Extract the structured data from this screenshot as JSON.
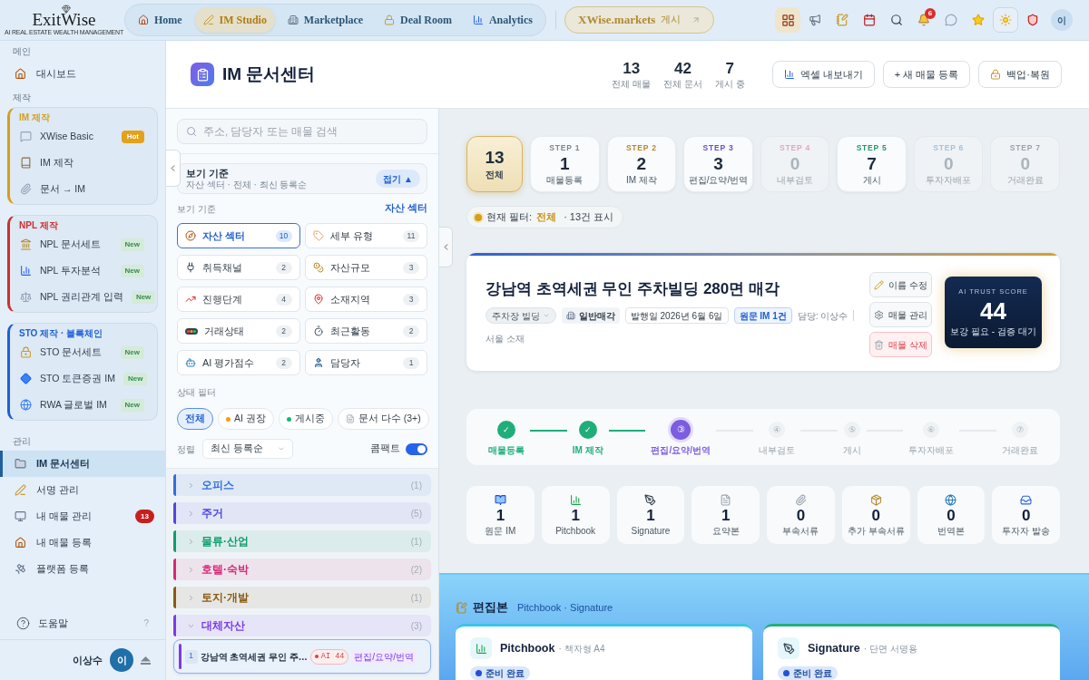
{
  "topbar": {
    "logo": {
      "wordmark": "ExitWise",
      "tagline": "AI REAL ESTATE WEALTH MANAGEMENT"
    },
    "nav": [
      {
        "label": "Home",
        "selected": false
      },
      {
        "label": "IM Studio",
        "selected": true
      },
      {
        "label": "Marketplace",
        "selected": false
      },
      {
        "label": "Deal Room",
        "selected": false
      },
      {
        "label": "Analytics",
        "selected": false
      }
    ],
    "publish_button": {
      "label": "XWise.markets",
      "suffix": "게시"
    },
    "notification_count": "6",
    "avatar": "이"
  },
  "sidebar": {
    "sections": [
      {
        "title": "메인",
        "entries": [
          {
            "kind": "item",
            "label": "대시보드",
            "selected": false
          }
        ]
      },
      {
        "title": "제작",
        "entries": [
          {
            "kind": "group",
            "title": "IM 제작",
            "color": "#d69e1c",
            "items": [
              {
                "label": "XWise Basic",
                "selected": false,
                "badge": {
                  "kind": "hot",
                  "text": "Hot"
                }
              },
              {
                "label": "IM 제작",
                "selected": false
              },
              {
                "label": "문서 → IM",
                "selected": false
              }
            ]
          },
          {
            "kind": "group",
            "title": "NPL 제작",
            "color": "#cf2e2e",
            "items": [
              {
                "label": "NPL 문서세트",
                "selected": false,
                "badge": {
                  "kind": "new",
                  "text": "New"
                }
              },
              {
                "label": "NPL 투자분석",
                "selected": false,
                "badge": {
                  "kind": "new",
                  "text": "New"
                }
              },
              {
                "label": "NPL 권리관계 입력",
                "selected": false,
                "badge": {
                  "kind": "new",
                  "text": "New"
                }
              }
            ]
          },
          {
            "kind": "group",
            "title": "STO 제작 · 블록체인",
            "color": "#1d5fd6",
            "items": [
              {
                "label": "STO 문서세트",
                "selected": false,
                "badge": {
                  "kind": "new",
                  "text": "New"
                }
              },
              {
                "label": "STO 토큰증권 IM",
                "selected": false,
                "badge": {
                  "kind": "new",
                  "text": "New"
                }
              },
              {
                "label": "RWA 글로벌 IM",
                "selected": false,
                "badge": {
                  "kind": "new",
                  "text": "New"
                }
              }
            ]
          }
        ]
      },
      {
        "title": "관리",
        "entries": [
          {
            "kind": "item",
            "label": "IM 문서센터",
            "selected": true
          },
          {
            "kind": "item",
            "label": "서명 관리",
            "selected": false
          },
          {
            "kind": "item",
            "label": "내 매물 관리",
            "selected": false,
            "badge": {
              "kind": "count",
              "text": "13"
            }
          },
          {
            "kind": "item",
            "label": "내 매물 등록",
            "selected": false
          },
          {
            "kind": "item",
            "label": "플랫폼 등록",
            "selected": false
          }
        ]
      }
    ],
    "help": {
      "label": "도움말",
      "shortcut": "?"
    },
    "user": {
      "name": "이상수",
      "avatar": "이"
    }
  },
  "header": {
    "title": "IM 문서센터",
    "stats": [
      {
        "value": "13",
        "label": "전체 매물"
      },
      {
        "value": "42",
        "label": "전체 문서"
      },
      {
        "value": "7",
        "label": "게시 중"
      }
    ],
    "actions": [
      {
        "kind": "export",
        "label": "엑셀 내보내기"
      },
      {
        "kind": "add",
        "label": "+ 새 매물 등록"
      },
      {
        "kind": "backup",
        "label": "백업·복원"
      }
    ]
  },
  "filter_panel": {
    "search": {
      "placeholder": "주소, 담당자 또는 매물 검색"
    },
    "view_summary": {
      "title": "보기 기준",
      "subtitle": "자산 섹터 · 전체 · 최신 등록순",
      "collapse_button": "접기 ▲"
    },
    "view_by": {
      "label": "보기 기준",
      "current": "자산 섹터",
      "options": [
        {
          "label": "자산 섹터",
          "count": "10",
          "selected": true
        },
        {
          "label": "세부 유형",
          "count": "11",
          "selected": false
        },
        {
          "label": "취득채널",
          "count": "2",
          "selected": false
        },
        {
          "label": "자산규모",
          "count": "3",
          "selected": false
        },
        {
          "label": "진행단계",
          "count": "4",
          "selected": false
        },
        {
          "label": "소재지역",
          "count": "3",
          "selected": false
        },
        {
          "label": "거래상태",
          "count": "2",
          "selected": false
        },
        {
          "label": "최근활동",
          "count": "2",
          "selected": false
        },
        {
          "label": "AI 평가점수",
          "count": "2",
          "selected": false
        },
        {
          "label": "담당자",
          "count": "1",
          "selected": false
        }
      ]
    },
    "status_filter": {
      "label": "상태 필터",
      "chips": [
        {
          "kind": "plain",
          "label": "전체",
          "selected": true
        },
        {
          "kind": "dot",
          "label": "AI 권장",
          "color": "#f59e0b",
          "selected": false
        },
        {
          "kind": "dot",
          "label": "게시중",
          "color": "#10b981",
          "selected": false
        },
        {
          "kind": "document",
          "label": "문서 다수 (3+)",
          "selected": false
        }
      ]
    },
    "sort": {
      "label": "정렬",
      "value": "최신 등록순"
    },
    "compact": {
      "label": "콤팩트",
      "on": true
    },
    "groups": [
      {
        "label": "오피스",
        "count": "(1)",
        "color": "#2f6fe0",
        "expanded": false
      },
      {
        "label": "주거",
        "count": "(5)",
        "color": "#4f46e5",
        "expanded": false
      },
      {
        "label": "물류·산업",
        "count": "(1)",
        "color": "#0f9d6b",
        "expanded": false
      },
      {
        "label": "호텔·숙박",
        "count": "(2)",
        "color": "#db2777",
        "expanded": false
      },
      {
        "label": "토지·개발",
        "count": "(1)",
        "color": "#8a5a12",
        "expanded": false
      },
      {
        "label": "대체자산",
        "count": "(3)",
        "color": "#7c3aed",
        "expanded": true,
        "children": [
          {
            "number": "1",
            "title": "강남역 초역세권 무인 주…",
            "score": "AI 44",
            "stage": "편집/요약/번역",
            "selected": true
          }
        ]
      }
    ]
  },
  "stage_cards": [
    {
      "kind": "total",
      "value": "13",
      "label": "전체",
      "selected": true,
      "disabled": false
    },
    {
      "kind": "step",
      "step": "STEP 1",
      "value": "1",
      "label": "매물등록",
      "color": "#7b8794",
      "selected": false,
      "disabled": false
    },
    {
      "kind": "step",
      "step": "STEP 2",
      "value": "2",
      "label": "IM 제작",
      "color": "#b8862b",
      "selected": false,
      "disabled": false
    },
    {
      "kind": "step",
      "step": "STEP 3",
      "value": "3",
      "label": "편집/요약/번역",
      "color": "#6a4fc4",
      "selected": false,
      "disabled": false
    },
    {
      "kind": "step",
      "step": "STEP 4",
      "value": "0",
      "label": "내부검토",
      "color": "#e2a7c2",
      "selected": false,
      "disabled": true
    },
    {
      "kind": "step",
      "step": "STEP 5",
      "value": "7",
      "label": "게시",
      "color": "#1f9a6a",
      "selected": false,
      "disabled": false
    },
    {
      "kind": "step",
      "step": "STEP 6",
      "value": "0",
      "label": "투자자배포",
      "color": "#a7c0e0",
      "selected": false,
      "disabled": true
    },
    {
      "kind": "step",
      "step": "STEP 7",
      "value": "0",
      "label": "거래완료",
      "color": "#9aa4ad",
      "selected": false,
      "disabled": true
    }
  ],
  "current_filter": {
    "label": "현재 필터:",
    "value": "전체",
    "note": "· 13건 표시"
  },
  "property": {
    "title": "강남역 초역세권 무인 주차빌딩 280면 매각",
    "tags": [
      {
        "kind": "dropdown",
        "label": "주차장 빌딩"
      },
      {
        "kind": "type",
        "label": "일반매각"
      },
      {
        "kind": "date",
        "label": "발행일 2026년 6월 6일"
      },
      {
        "kind": "source",
        "label": "원문 IM 1건"
      },
      {
        "kind": "owner",
        "label": "담당: 이상수"
      }
    ],
    "location": "서울 소재",
    "actions": [
      {
        "kind": "edit",
        "label": "이름 수정"
      },
      {
        "kind": "manage",
        "label": "매물 관리"
      },
      {
        "kind": "delete",
        "label": "매물 삭제"
      }
    ],
    "trust_score": {
      "title": "AI TRUST SCORE",
      "score": "44",
      "note": "보강 필요 - 검증 대기"
    }
  },
  "progress": [
    {
      "label": "매물등록",
      "mark": "✓",
      "done": true,
      "current": false
    },
    {
      "label": "IM 제작",
      "mark": "✓",
      "done": true,
      "current": false
    },
    {
      "label": "편집/요약/번역",
      "mark": "③",
      "done": false,
      "current": true
    },
    {
      "label": "내부검토",
      "mark": "④",
      "done": false,
      "current": false
    },
    {
      "label": "게시",
      "mark": "⑤",
      "done": false,
      "current": false
    },
    {
      "label": "투자자배포",
      "mark": "⑥",
      "done": false,
      "current": false
    },
    {
      "label": "거래완료",
      "mark": "⑦",
      "done": false,
      "current": false
    }
  ],
  "documents": [
    {
      "count": "1",
      "label": "원문 IM"
    },
    {
      "count": "1",
      "label": "Pitchbook"
    },
    {
      "count": "1",
      "label": "Signature"
    },
    {
      "count": "1",
      "label": "요약본"
    },
    {
      "count": "0",
      "label": "부속서류"
    },
    {
      "count": "0",
      "label": "추가 부속서류"
    },
    {
      "count": "0",
      "label": "번역본"
    },
    {
      "count": "0",
      "label": "투자자 발송"
    }
  ],
  "edited": {
    "title": "편집본",
    "subtitle": "Pitchbook · Signature",
    "cards": [
      {
        "name": "Pitchbook",
        "detail": "· 책자형 A4",
        "status": "준비 완료",
        "color": "#38c6e8"
      },
      {
        "name": "Signature",
        "detail": "· 단면 서명용",
        "status": "준비 완료",
        "color": "#22b07d"
      }
    ]
  }
}
